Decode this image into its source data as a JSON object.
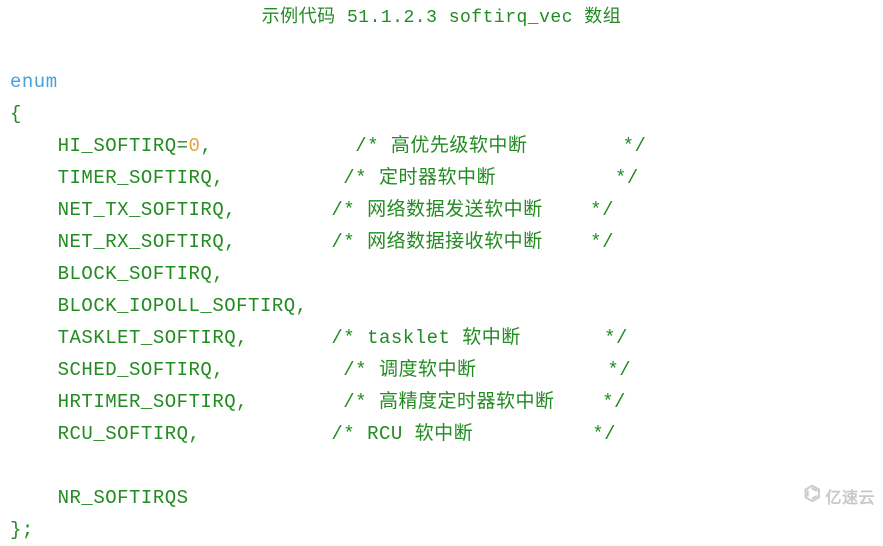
{
  "title": "示例代码 51.1.2.3 softirq_vec 数组",
  "code": {
    "kw_enum": "enum",
    "brace_open": "{",
    "l1_name": "    HI_SOFTIRQ",
    "l1_eq": "=",
    "l1_num": "0",
    "l1_comma": ",",
    "l1_pad": "            ",
    "l1_c": "/* 高优先级软中断        */",
    "l2": "    TIMER_SOFTIRQ,",
    "l2_pad": "          ",
    "l2_c": "/* 定时器软中断          */",
    "l3": "    NET_TX_SOFTIRQ,",
    "l3_pad": "        ",
    "l3_c": "/* 网络数据发送软中断    */",
    "l4": "    NET_RX_SOFTIRQ,",
    "l4_pad": "        ",
    "l4_c": "/* 网络数据接收软中断    */",
    "l5": "    BLOCK_SOFTIRQ,",
    "l6": "    BLOCK_IOPOLL_SOFTIRQ,",
    "l7": "    TASKLET_SOFTIRQ,",
    "l7_pad": "       ",
    "l7_c": "/* tasklet 软中断       */",
    "l8": "    SCHED_SOFTIRQ,",
    "l8_pad": "          ",
    "l8_c": "/* 调度软中断           */",
    "l9": "    HRTIMER_SOFTIRQ,",
    "l9_pad": "        ",
    "l9_c": "/* 高精度定时器软中断    */",
    "l10": "    RCU_SOFTIRQ,",
    "l10_pad": "           ",
    "l10_c": "/* RCU 软中断          */",
    "blank": "",
    "l11": "    NR_SOFTIRQS",
    "brace_close": "};"
  },
  "watermark": {
    "icon": "⌬",
    "text": "亿速云"
  }
}
